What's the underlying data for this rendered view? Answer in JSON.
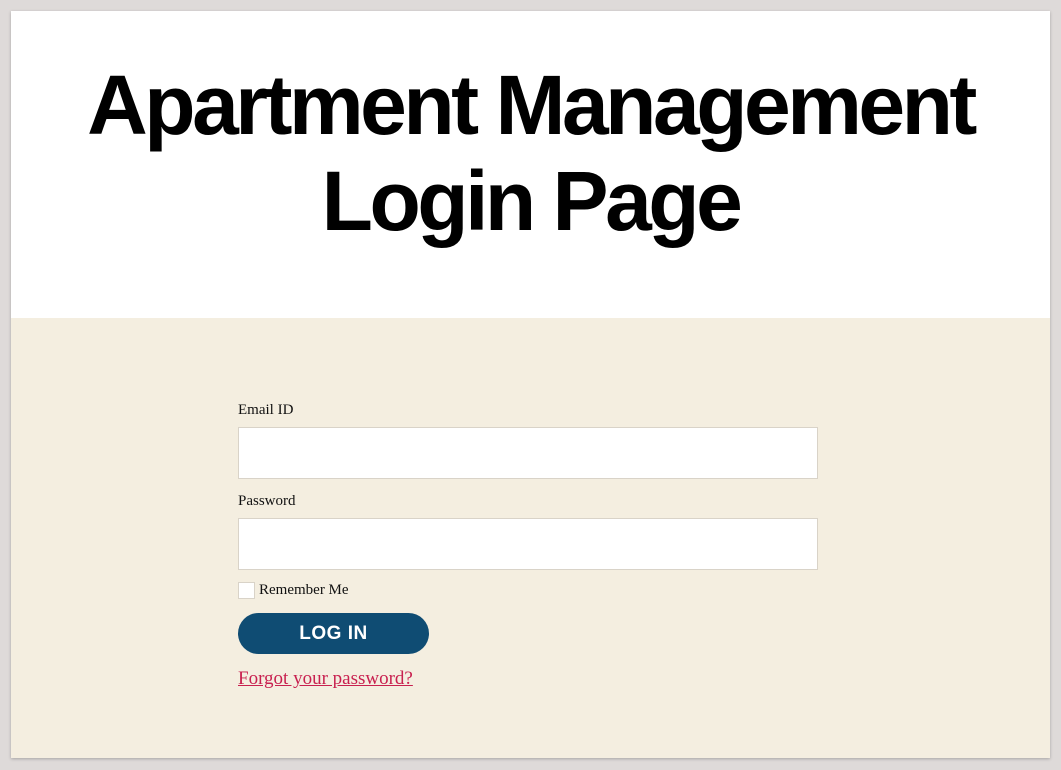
{
  "header": {
    "title_line1": "Apartment Management",
    "title_line2": "Login Page"
  },
  "form": {
    "email_label": "Email ID",
    "email_value": "",
    "password_label": "Password",
    "password_value": "",
    "remember_label": "Remember Me",
    "remember_checked": false,
    "login_label": "LOG IN",
    "forgot_label": "Forgot your password?"
  },
  "colors": {
    "background": "#f4eee0",
    "button": "#0f4c73",
    "link": "#c8204f"
  }
}
